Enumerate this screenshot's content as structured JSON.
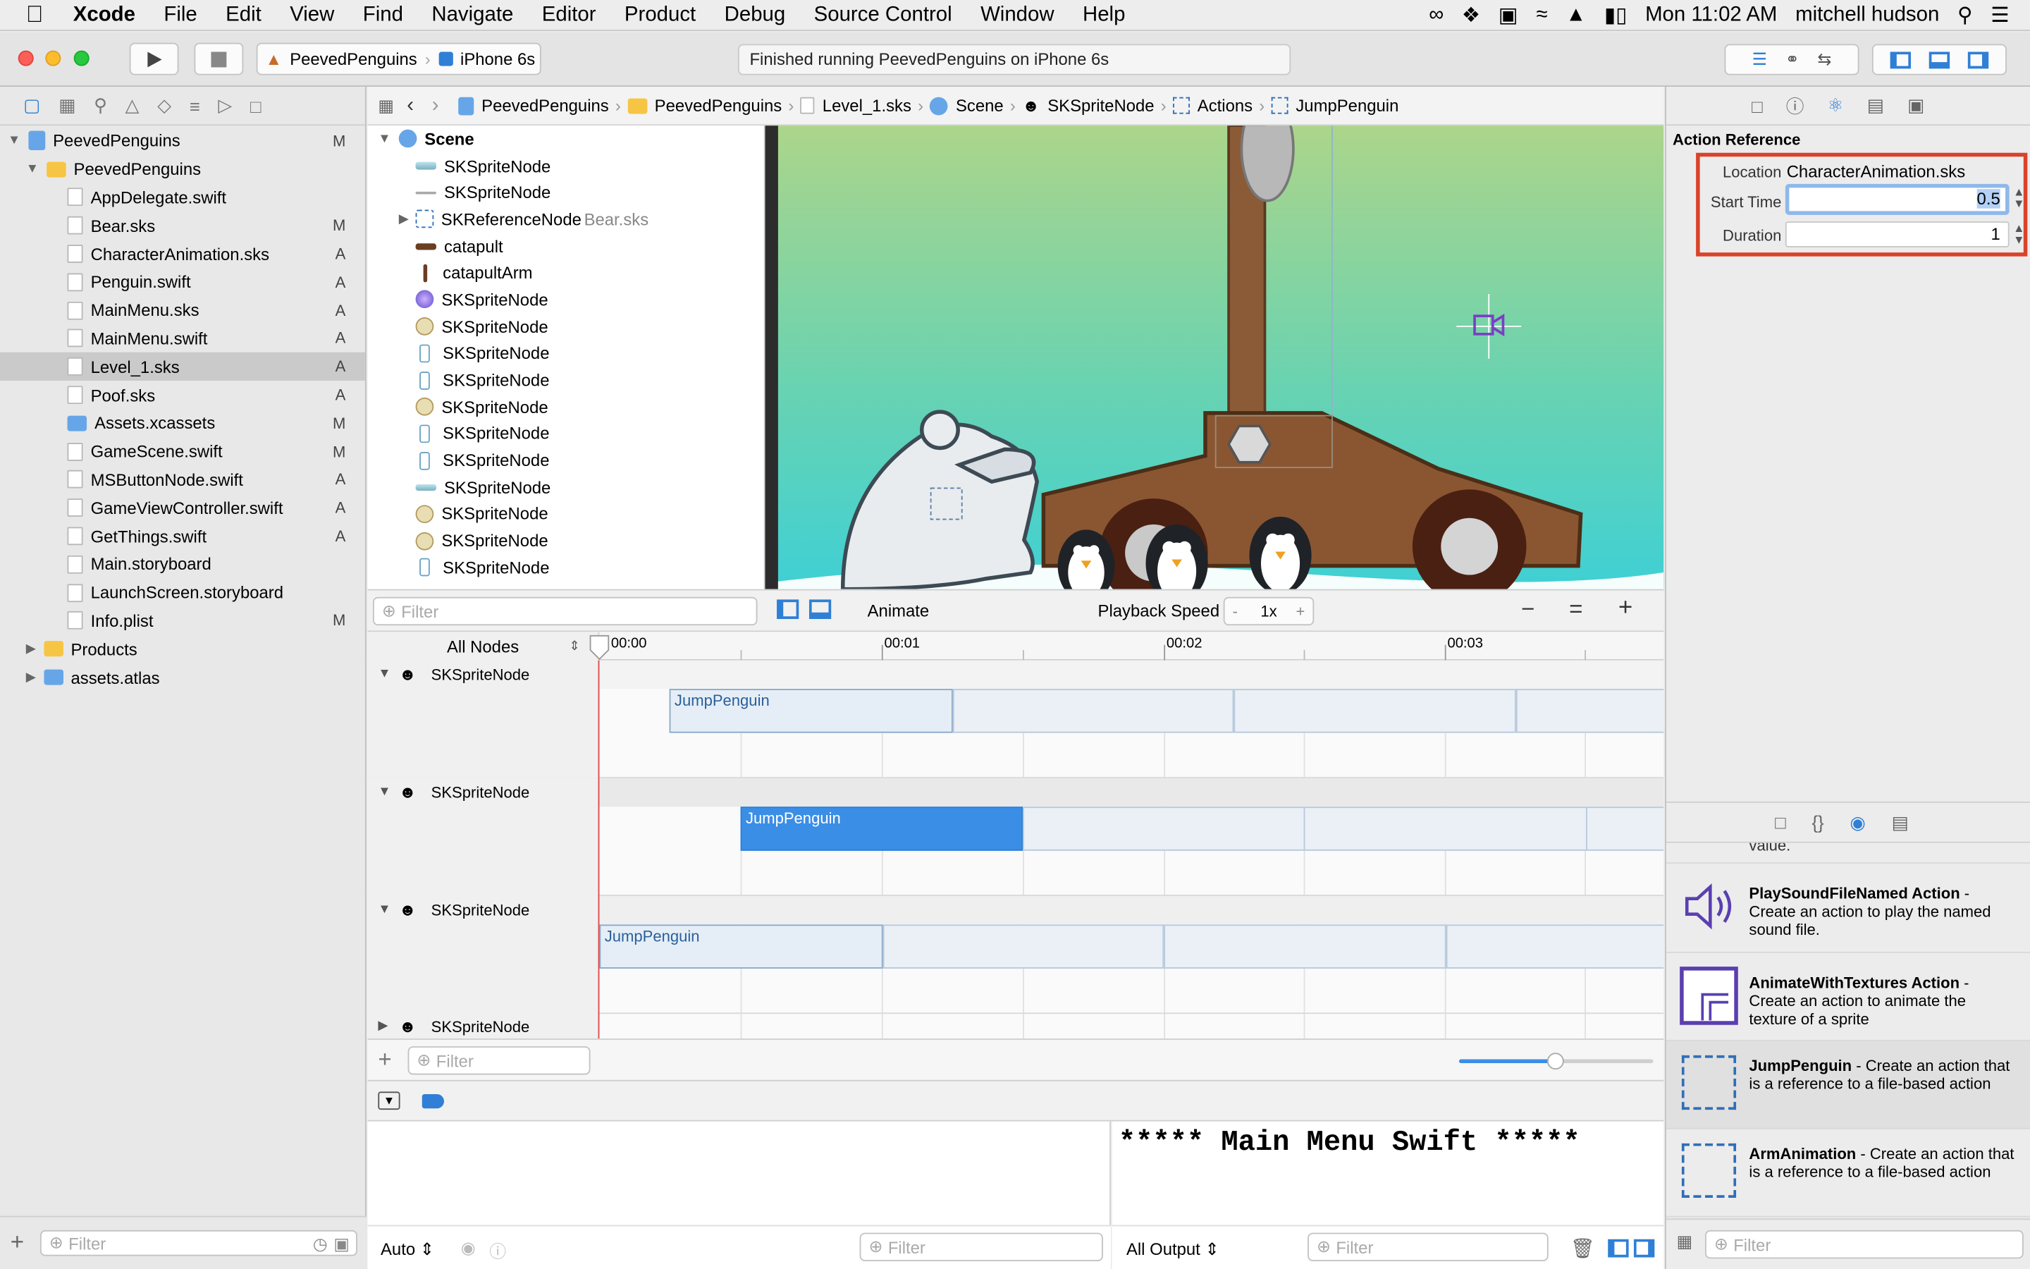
{
  "menubar": {
    "app": "Xcode",
    "items": [
      "File",
      "Edit",
      "View",
      "Find",
      "Navigate",
      "Editor",
      "Product",
      "Debug",
      "Source Control",
      "Window",
      "Help"
    ],
    "clock": "Mon 11:02 AM",
    "user": "mitchell hudson"
  },
  "toolbar": {
    "scheme": "PeevedPenguins",
    "device": "iPhone 6s",
    "status": "Finished running PeevedPenguins on iPhone 6s"
  },
  "navigator": {
    "items": [
      {
        "name": "PeevedPenguins",
        "status": "M"
      },
      {
        "name": "PeevedPenguins",
        "status": ""
      },
      {
        "name": "AppDelegate.swift",
        "status": ""
      },
      {
        "name": "Bear.sks",
        "status": "M"
      },
      {
        "name": "CharacterAnimation.sks",
        "status": "A"
      },
      {
        "name": "Penguin.swift",
        "status": "A"
      },
      {
        "name": "MainMenu.sks",
        "status": "A"
      },
      {
        "name": "MainMenu.swift",
        "status": "A"
      },
      {
        "name": "Level_1.sks",
        "status": "A"
      },
      {
        "name": "Poof.sks",
        "status": "A"
      },
      {
        "name": "Assets.xcassets",
        "status": "M"
      },
      {
        "name": "GameScene.swift",
        "status": "M"
      },
      {
        "name": "MSButtonNode.swift",
        "status": "A"
      },
      {
        "name": "GameViewController.swift",
        "status": "A"
      },
      {
        "name": "GetThings.swift",
        "status": "A"
      },
      {
        "name": "Main.storyboard",
        "status": ""
      },
      {
        "name": "LaunchScreen.storyboard",
        "status": ""
      },
      {
        "name": "Info.plist",
        "status": "M"
      },
      {
        "name": "Products",
        "status": ""
      },
      {
        "name": "assets.atlas",
        "status": ""
      }
    ],
    "filter_placeholder": "Filter"
  },
  "jumpbar": [
    "PeevedPenguins",
    "PeevedPenguins",
    "Level_1.sks",
    "Scene",
    "SKSpriteNode",
    "Actions",
    "JumpPenguin"
  ],
  "scene_outline": {
    "root": "Scene",
    "nodes": [
      {
        "name": "SKSpriteNode",
        "extra": ""
      },
      {
        "name": "SKSpriteNode",
        "extra": ""
      },
      {
        "name": "SKReferenceNode",
        "extra": "Bear.sks"
      },
      {
        "name": "catapult",
        "extra": ""
      },
      {
        "name": "catapultArm",
        "extra": ""
      },
      {
        "name": "SKSpriteNode",
        "extra": ""
      },
      {
        "name": "SKSpriteNode",
        "extra": ""
      },
      {
        "name": "SKSpriteNode",
        "extra": ""
      },
      {
        "name": "SKSpriteNode",
        "extra": ""
      },
      {
        "name": "SKSpriteNode",
        "extra": ""
      },
      {
        "name": "SKSpriteNode",
        "extra": ""
      },
      {
        "name": "SKSpriteNode",
        "extra": ""
      },
      {
        "name": "SKSpriteNode",
        "extra": ""
      },
      {
        "name": "SKSpriteNode",
        "extra": ""
      },
      {
        "name": "SKSpriteNode",
        "extra": ""
      },
      {
        "name": "SKSpriteNode",
        "extra": ""
      }
    ],
    "filter_placeholder": "Filter"
  },
  "editor_bar": {
    "animate": "Animate",
    "playback_label": "Playback Speed",
    "minus": "-",
    "speed": "1x",
    "plus": "+"
  },
  "timeline": {
    "nodes_selector": "All Nodes",
    "ticks": [
      "00:00",
      "00:01",
      "00:02",
      "00:03"
    ],
    "tracks": [
      {
        "name": "SKSpriteNode",
        "action": "JumpPenguin"
      },
      {
        "name": "SKSpriteNode",
        "action": "JumpPenguin"
      },
      {
        "name": "SKSpriteNode",
        "action": "JumpPenguin"
      },
      {
        "name": "SKSpriteNode",
        "action": ""
      }
    ],
    "filter_placeholder": "Filter"
  },
  "debug": {
    "auto": "Auto",
    "all_output": "All Output",
    "console_text": "***** Main Menu Swift *****",
    "filter_placeholder": "Filter"
  },
  "inspector": {
    "section": "Action Reference",
    "location_label": "Location",
    "location_value": "CharacterAnimation.sks",
    "start_label": "Start Time",
    "start_value": "0.5",
    "duration_label": "Duration",
    "duration_value": "1",
    "highlight_color": "#d9432a"
  },
  "library": {
    "partial_text": "value.",
    "items": [
      {
        "title": "PlaySoundFileNamed Action",
        "desc": "Create an action to play the named sound file."
      },
      {
        "title": "AnimateWithTextures Action",
        "desc": "Create an action to animate the texture of a sprite"
      },
      {
        "title": "JumpPenguin",
        "desc": "Create an action that is a reference to a file-based action"
      },
      {
        "title": "ArmAnimation",
        "desc": "Create an action that is a reference to a file-based action"
      }
    ],
    "filter_placeholder": "Filter"
  }
}
